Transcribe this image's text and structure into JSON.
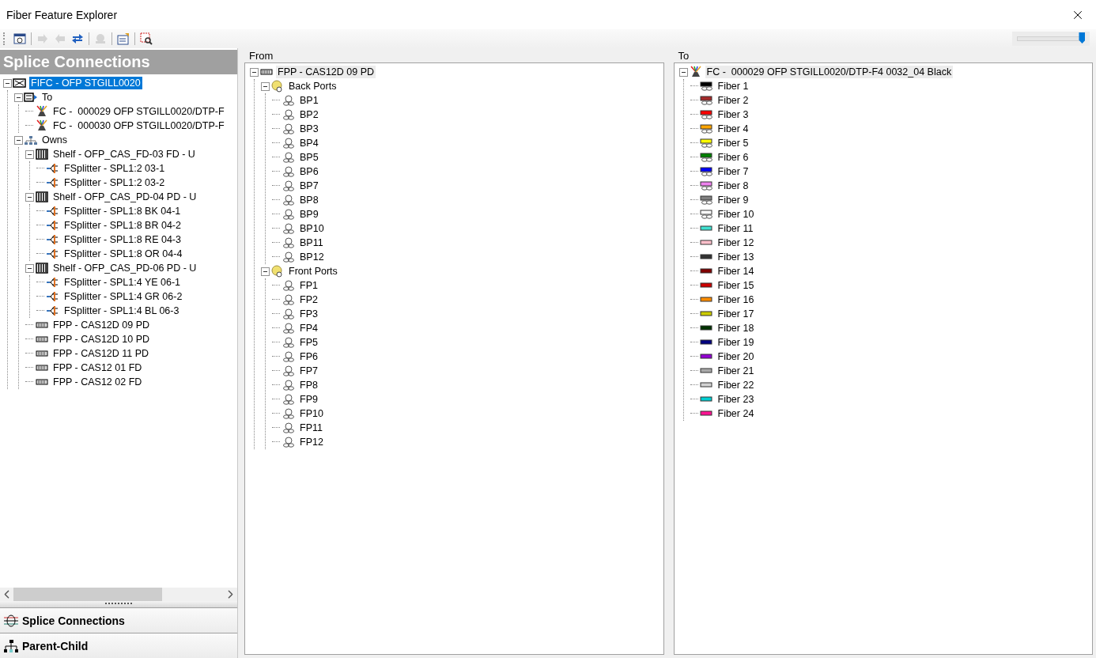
{
  "window": {
    "title": "Fiber Feature Explorer"
  },
  "toolbar": {
    "buttons": [
      {
        "kind": "preview",
        "disabled": false
      },
      {
        "kind": "forward",
        "disabled": true
      },
      {
        "kind": "back",
        "disabled": true
      },
      {
        "kind": "swap",
        "disabled": false
      },
      {
        "kind": "network",
        "disabled": true
      },
      {
        "kind": "properties",
        "disabled": false
      },
      {
        "kind": "find",
        "disabled": false
      }
    ],
    "slider": {
      "level": 0.97
    }
  },
  "navigator": {
    "title": "Splice Connections",
    "focused": true,
    "tree": [
      {
        "kind": "closure",
        "label": "FIFC - OFP STGILL0020",
        "selected": true,
        "expanded": true,
        "children": [
          {
            "kind": "to",
            "label": "To",
            "selected": false,
            "expanded": true,
            "children": [
              {
                "kind": "cable",
                "label": "FC -  000029 OFP STGILL0020/DTP-F",
                "selected": false
              },
              {
                "kind": "cable",
                "label": "FC -  000030 OFP STGILL0020/DTP-F",
                "selected": false
              }
            ]
          },
          {
            "kind": "owns",
            "label": "Owns",
            "selected": false,
            "expanded": true,
            "children": [
              {
                "kind": "shelf",
                "label": "Shelf - OFP_CAS_FD-03 FD - U",
                "selected": false,
                "expanded": true,
                "children": [
                  {
                    "kind": "splitter",
                    "label": "FSplitter - SPL1:2 03-1",
                    "selected": false
                  },
                  {
                    "kind": "splitter",
                    "label": "FSplitter - SPL1:2 03-2",
                    "selected": false
                  }
                ]
              },
              {
                "kind": "shelf",
                "label": "Shelf - OFP_CAS_PD-04 PD - U",
                "selected": false,
                "expanded": true,
                "children": [
                  {
                    "kind": "splitter",
                    "label": "FSplitter - SPL1:8 BK 04-1",
                    "selected": false
                  },
                  {
                    "kind": "splitter",
                    "label": "FSplitter - SPL1:8 BR 04-2",
                    "selected": false
                  },
                  {
                    "kind": "splitter",
                    "label": "FSplitter - SPL1:8 RE 04-3",
                    "selected": false
                  },
                  {
                    "kind": "splitter",
                    "label": "FSplitter - SPL1:8 OR 04-4",
                    "selected": false
                  }
                ]
              },
              {
                "kind": "shelf",
                "label": "Shelf - OFP_CAS_PD-06 PD - U",
                "selected": false,
                "expanded": true,
                "children": [
                  {
                    "kind": "splitter",
                    "label": "FSplitter - SPL1:4 YE 06-1",
                    "selected": false
                  },
                  {
                    "kind": "splitter",
                    "label": "FSplitter - SPL1:4 GR 06-2",
                    "selected": false
                  },
                  {
                    "kind": "splitter",
                    "label": "FSplitter - SPL1:4 BL 06-3",
                    "selected": false
                  }
                ]
              },
              {
                "kind": "panel",
                "label": "FPP - CAS12D 09 PD",
                "selected": false
              },
              {
                "kind": "panel",
                "label": "FPP - CAS12D 10 PD",
                "selected": false
              },
              {
                "kind": "panel",
                "label": "FPP - CAS12D 11 PD",
                "selected": false
              },
              {
                "kind": "panel",
                "label": "FPP - CAS12 01 FD",
                "selected": false
              },
              {
                "kind": "panel",
                "label": "FPP - CAS12 02 FD",
                "selected": false
              }
            ]
          }
        ]
      }
    ],
    "nav_buttons": [
      {
        "kind": "splice",
        "label": "Splice Connections"
      },
      {
        "kind": "hierarchy",
        "label": "Parent-Child"
      }
    ]
  },
  "from": {
    "title": "From",
    "focused": false,
    "tree": [
      {
        "kind": "panel",
        "label": "FPP - CAS12D 09 PD",
        "selected": true,
        "expanded": true,
        "children": [
          {
            "kind": "ports",
            "label": "Back Ports",
            "selected": false,
            "expanded": true,
            "children": [
              {
                "kind": "port",
                "label": "BP1",
                "selected": false
              },
              {
                "kind": "port",
                "label": "BP2",
                "selected": false
              },
              {
                "kind": "port",
                "label": "BP3",
                "selected": false
              },
              {
                "kind": "port",
                "label": "BP4",
                "selected": false
              },
              {
                "kind": "port",
                "label": "BP5",
                "selected": false
              },
              {
                "kind": "port",
                "label": "BP6",
                "selected": false
              },
              {
                "kind": "port",
                "label": "BP7",
                "selected": false
              },
              {
                "kind": "port",
                "label": "BP8",
                "selected": false
              },
              {
                "kind": "port",
                "label": "BP9",
                "selected": false
              },
              {
                "kind": "port",
                "label": "BP10",
                "selected": false
              },
              {
                "kind": "port",
                "label": "BP11",
                "selected": false
              },
              {
                "kind": "port",
                "label": "BP12",
                "selected": false
              }
            ]
          },
          {
            "kind": "ports",
            "label": "Front Ports",
            "selected": false,
            "expanded": true,
            "children": [
              {
                "kind": "port",
                "label": "FP1",
                "selected": false
              },
              {
                "kind": "port",
                "label": "FP2",
                "selected": false
              },
              {
                "kind": "port",
                "label": "FP3",
                "selected": false
              },
              {
                "kind": "port",
                "label": "FP4",
                "selected": false
              },
              {
                "kind": "port",
                "label": "FP5",
                "selected": false
              },
              {
                "kind": "port",
                "label": "FP6",
                "selected": false
              },
              {
                "kind": "port",
                "label": "FP7",
                "selected": false
              },
              {
                "kind": "port",
                "label": "FP8",
                "selected": false
              },
              {
                "kind": "port",
                "label": "FP9",
                "selected": false
              },
              {
                "kind": "port",
                "label": "FP10",
                "selected": false
              },
              {
                "kind": "port",
                "label": "FP11",
                "selected": false
              },
              {
                "kind": "port",
                "label": "FP12",
                "selected": false
              }
            ]
          }
        ]
      }
    ]
  },
  "to": {
    "title": "To",
    "focused": false,
    "tree": [
      {
        "kind": "cable",
        "label": "FC -  000029 OFP STGILL0020/DTP-F4 0032_04 Black",
        "selected": true,
        "expanded": true,
        "children": [
          {
            "kind": "fiber-linked",
            "label": "Fiber 1",
            "color": "#000000",
            "selected": false
          },
          {
            "kind": "fiber-linked",
            "label": "Fiber 2",
            "color": "#a52a2a",
            "selected": false
          },
          {
            "kind": "fiber-linked",
            "label": "Fiber 3",
            "color": "#ff0000",
            "selected": false
          },
          {
            "kind": "fiber-linked",
            "label": "Fiber 4",
            "color": "#ffa500",
            "selected": false
          },
          {
            "kind": "fiber-linked",
            "label": "Fiber 5",
            "color": "#ffff00",
            "selected": false
          },
          {
            "kind": "fiber-linked",
            "label": "Fiber 6",
            "color": "#008000",
            "selected": false
          },
          {
            "kind": "fiber-linked",
            "label": "Fiber 7",
            "color": "#0000ff",
            "selected": false
          },
          {
            "kind": "fiber-linked",
            "label": "Fiber 8",
            "color": "#ee82ee",
            "selected": false
          },
          {
            "kind": "fiber-linked",
            "label": "Fiber 9",
            "color": "#808080",
            "selected": false
          },
          {
            "kind": "fiber-linked",
            "label": "Fiber 10",
            "color": "#ffffff",
            "selected": false
          },
          {
            "kind": "fiber",
            "label": "Fiber 11",
            "color": "#40e0d0",
            "selected": false
          },
          {
            "kind": "fiber",
            "label": "Fiber 12",
            "color": "#ffc0cb",
            "selected": false
          },
          {
            "kind": "fiber",
            "label": "Fiber 13",
            "color": "#333333",
            "selected": false
          },
          {
            "kind": "fiber",
            "label": "Fiber 14",
            "color": "#800000",
            "selected": false
          },
          {
            "kind": "fiber",
            "label": "Fiber 15",
            "color": "#cc0000",
            "selected": false
          },
          {
            "kind": "fiber",
            "label": "Fiber 16",
            "color": "#ff8c00",
            "selected": false
          },
          {
            "kind": "fiber",
            "label": "Fiber 17",
            "color": "#cccc00",
            "selected": false
          },
          {
            "kind": "fiber",
            "label": "Fiber 18",
            "color": "#003300",
            "selected": false
          },
          {
            "kind": "fiber",
            "label": "Fiber 19",
            "color": "#000080",
            "selected": false
          },
          {
            "kind": "fiber",
            "label": "Fiber 20",
            "color": "#9400d3",
            "selected": false
          },
          {
            "kind": "fiber",
            "label": "Fiber 21",
            "color": "#a9a9a9",
            "selected": false
          },
          {
            "kind": "fiber",
            "label": "Fiber 22",
            "color": "#d3d3d3",
            "selected": false
          },
          {
            "kind": "fiber",
            "label": "Fiber 23",
            "color": "#00ced1",
            "selected": false
          },
          {
            "kind": "fiber",
            "label": "Fiber 24",
            "color": "#ff1493",
            "selected": false
          }
        ]
      }
    ]
  }
}
